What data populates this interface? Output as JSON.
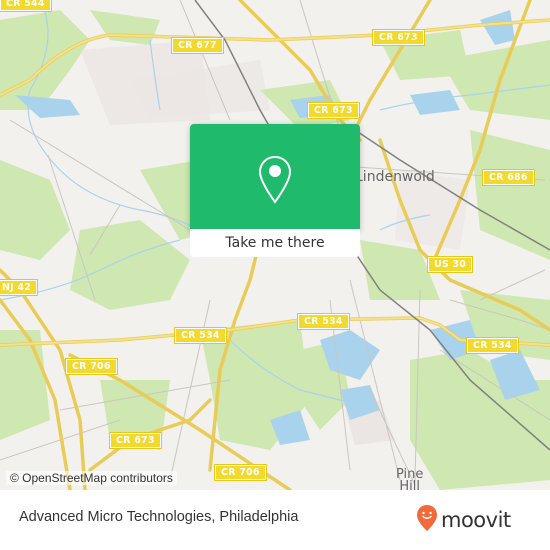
{
  "map": {
    "road_labels": [
      {
        "id": "cr-544",
        "text": "CR 544"
      },
      {
        "id": "cr-677",
        "text": "CR 677"
      },
      {
        "id": "cr-673-top",
        "text": "CR 673"
      },
      {
        "id": "cr-673-mid",
        "text": "CR 673"
      },
      {
        "id": "cr-686",
        "text": "CR 686"
      },
      {
        "id": "us-30",
        "text": "US 30"
      },
      {
        "id": "nj-42",
        "text": "NJ 42"
      },
      {
        "id": "cr-534-left",
        "text": "CR 534"
      },
      {
        "id": "cr-534-mid",
        "text": "CR 534"
      },
      {
        "id": "cr-534-right",
        "text": "CR 534"
      },
      {
        "id": "cr-706-left",
        "text": "CR 706"
      },
      {
        "id": "cr-673-bottom",
        "text": "CR 673"
      },
      {
        "id": "cr-706-bottom",
        "text": "CR 706"
      }
    ],
    "place_labels": [
      {
        "id": "lindenwold",
        "text": "Lindenwold"
      },
      {
        "id": "pine-hill",
        "text": "Pine\nHill"
      }
    ],
    "attribution": "© OpenStreetMap contributors",
    "colors": {
      "land": "#f2f1ee",
      "park": "#cfe7b0",
      "water": "#a9d3ec",
      "road_major": "#f5d96a",
      "road_minor": "#c9c6c1",
      "rail": "#777777"
    }
  },
  "popup": {
    "icon": "location-pin-icon",
    "button_label": "Take me there",
    "color": "#1fba6b"
  },
  "footer": {
    "title": "Advanced Micro Technologies, Philadelphia",
    "logo_text": "moovit",
    "logo_color": "#f26a3a"
  }
}
